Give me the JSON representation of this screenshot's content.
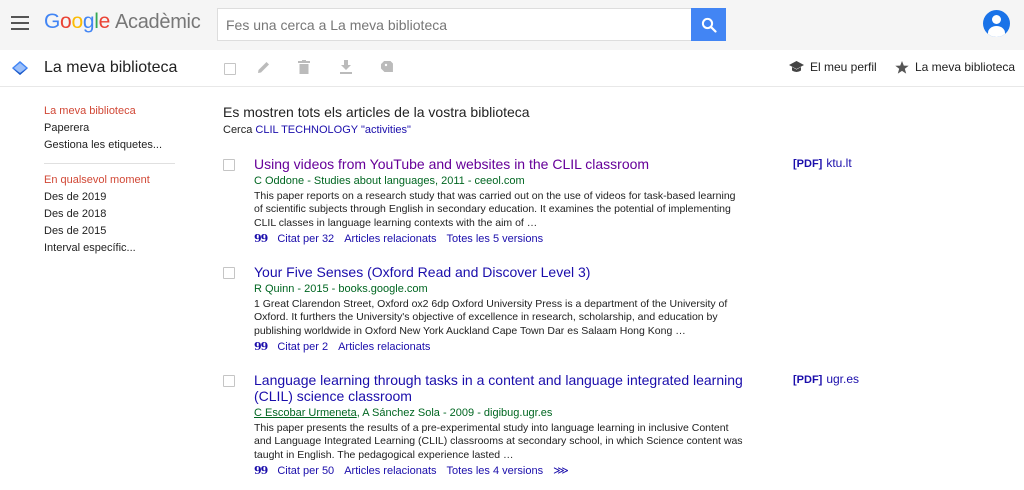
{
  "header": {
    "logo": {
      "g1": "G",
      "g2": "o",
      "g3": "o",
      "g4": "g",
      "g5": "l",
      "g6": "e",
      "product": "Acadèmic"
    },
    "search": {
      "placeholder": "Fes una cerca a La meva biblioteca",
      "value": ""
    },
    "menu_icon": "menu-icon",
    "search_icon": "search-icon",
    "account_icon": "account-icon"
  },
  "toolbar": {
    "library_title": "La meva biblioteca",
    "actions": [
      "select-all-checkbox",
      "edit-icon",
      "delete-icon",
      "download-icon",
      "label-icon"
    ],
    "profile_label": "El meu perfil",
    "library_label": "La meva biblioteca"
  },
  "sidebar": {
    "group1": [
      {
        "label": "La meva biblioteca",
        "active": true
      },
      {
        "label": "Paperera",
        "active": false
      },
      {
        "label": "Gestiona les etiquetes...",
        "active": false
      }
    ],
    "group2": [
      {
        "label": "En qualsevol moment",
        "active": true
      },
      {
        "label": "Des de 2019",
        "active": false
      },
      {
        "label": "Des de 2018",
        "active": false
      },
      {
        "label": "Des de 2015",
        "active": false
      },
      {
        "label": "Interval específic...",
        "active": false
      }
    ]
  },
  "main": {
    "heading": "Es mostren tots els articles de la vostra biblioteca",
    "query_prefix": "Cerca",
    "query": "CLIL TECHNOLOGY \"activities\"",
    "results": [
      {
        "title": "Using videos from YouTube and websites in the CLIL classroom",
        "authors": "C Oddone - Studies about languages, 2011 - ceeol.com",
        "snippet": "This paper reports on a research study that was carried out on the use of videos for task-based learning of scientific subjects through English in secondary education. It examines the potential of implementing CLIL classes in language learning contexts with the aim of …",
        "cited": "Citat per 32",
        "related": "Articles relacionats",
        "versions": "Totes les 5 versions",
        "pdf_tag": "[PDF]",
        "pdf_source": "ktu.lt"
      },
      {
        "title": "Your Five Senses (Oxford Read and Discover Level 3)",
        "authors": "R Quinn - 2015 - books.google.com",
        "snippet": "1 Great Clarendon Street, Oxford ox2 6dp Oxford University Press is a department of the University of Oxford. It furthers the University's objective of excellence in research, scholarship, and education by publishing worldwide in Oxford New York Auckland Cape Town Dar es Salaam Hong Kong …",
        "cited": "Citat per 2",
        "related": "Articles relacionats"
      },
      {
        "title": "Language learning through tasks in a content and language integrated learning (CLIL) science classroom",
        "authors_link": "C Escobar Urmeneta",
        "authors_rest": ", A Sánchez Sola - 2009 - digibug.ugr.es",
        "snippet": "This paper presents the results of a pre-experimental study into language learning in inclusive Content and Language Integrated Learning (CLIL) classrooms at secondary school, in which Science content was taught in English. The pedagogical experience lasted …",
        "cited": "Citat per 50",
        "related": "Articles relacionats",
        "versions": "Totes les 4 versions",
        "more": "⋙",
        "pdf_tag": "[PDF]",
        "pdf_source": "ugr.es"
      }
    ]
  },
  "colors": {
    "accent": "#4285f4",
    "link": "#1a0dab",
    "visited": "#660099",
    "source": "#006621",
    "active": "#d14836"
  }
}
